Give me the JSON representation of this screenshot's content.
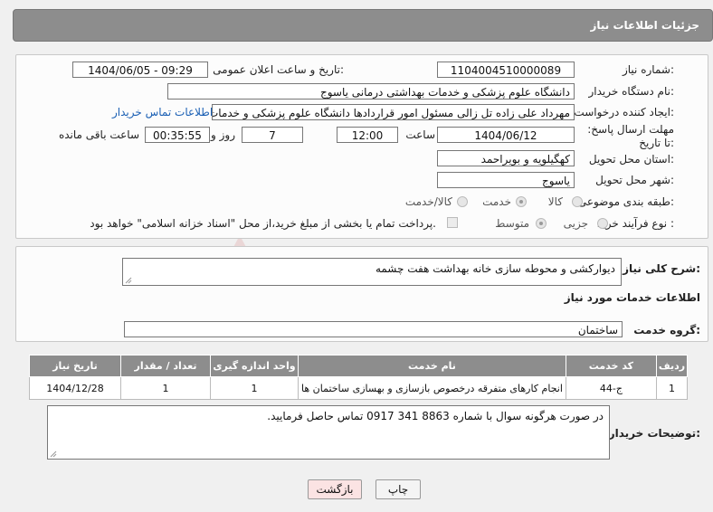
{
  "header": {
    "title": "جزئیات اطلاعات نیاز"
  },
  "form": {
    "need_number_label": "شماره نیاز:",
    "need_number": "1104004510000089",
    "announce_label": "تاریخ و ساعت اعلان عمومی:",
    "announce_value": "1404/06/05 - 09:29",
    "buyer_org_label": "نام دستگاه خریدار:",
    "buyer_org": "دانشگاه علوم پزشکی و خدمات بهداشتی  درمانی یاسوج",
    "requester_label": "ایجاد کننده درخواست:",
    "requester": "مهرداد علی زاده تل زالی مسئول امور قراردادها دانشگاه علوم پزشکی و خدمات",
    "buyer_contact_link": "اطلاعات تماس خریدار",
    "deadline_label": "مهلت ارسال پاسخ: تا تاریخ:",
    "deadline_date": "1404/06/12",
    "time_label": "ساعت",
    "deadline_time": "12:00",
    "days_value": "7",
    "days_label": "روز و",
    "remaining_time": "00:35:55",
    "remaining_label": "ساعت باقی مانده",
    "province_label": "استان محل تحویل:",
    "province": "کهگیلویه و بویراحمد",
    "city_label": "شهر محل تحویل:",
    "city": "یاسوج",
    "category_label": "طبقه بندی موضوعی:",
    "category_options": [
      "کالا",
      "خدمت",
      "کالا/خدمت"
    ],
    "purchase_type_label": "نوع فرآیند خرید :",
    "purchase_options": [
      "جزیی",
      "متوسط"
    ],
    "treasury_note": "پرداخت تمام یا بخشی از مبلغ خرید،از محل \"اسناد خزانه اسلامی\" خواهد بود."
  },
  "description": {
    "label": "شرح کلی نیاز:",
    "value": "دیوارکشی و محوطه سازی خانه بهداشت هفت چشمه"
  },
  "services": {
    "section_title": "اطلاعات خدمات مورد نیاز",
    "group_label": "گروه خدمت:",
    "group_value": "ساختمان",
    "columns": [
      "ردیف",
      "کد خدمت",
      "نام خدمت",
      "واحد اندازه گیری",
      "تعداد / مقدار",
      "تاریخ نیاز"
    ],
    "rows": [
      [
        "1",
        "ج-44",
        "انجام کارهای متفرقه درخصوص بازسازی و بهسازی ساختمان ها",
        "1",
        "1",
        "1404/12/28"
      ]
    ]
  },
  "buyer_notes": {
    "label": "توضیحات خریدار:",
    "value": "در صورت هرگونه سوال با شماره 8863 341 0917 تماس حاصل فرمایید."
  },
  "buttons": {
    "print": "چاپ",
    "back": "بازگشت"
  },
  "watermark": {
    "text": "AriaTender.neT"
  },
  "colors": {
    "header_bg": "#8d8d8d",
    "link": "#1a5fb4",
    "back_button_bg": "#fbe3e3"
  }
}
